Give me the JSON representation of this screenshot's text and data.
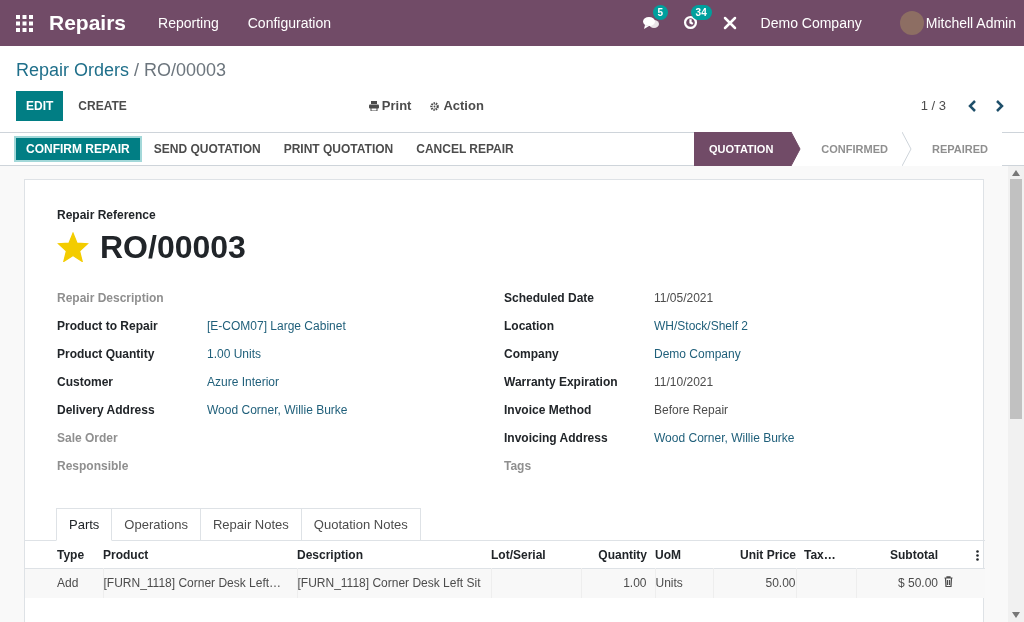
{
  "navbar": {
    "app": "Repairs",
    "menu": [
      "Reporting",
      "Configuration"
    ],
    "messages_count": "5",
    "activities_count": "34",
    "company": "Demo Company",
    "user": "Mitchell Admin"
  },
  "breadcrumb": {
    "parent": "Repair Orders",
    "separator": "/",
    "current": "RO/00003"
  },
  "buttons": {
    "edit": "EDIT",
    "create": "CREATE",
    "print": "Print",
    "action": "Action"
  },
  "pager": "1 / 3",
  "header_buttons": [
    {
      "label": "CONFIRM REPAIR",
      "primary": true
    },
    {
      "label": "SEND QUOTATION",
      "primary": false
    },
    {
      "label": "PRINT QUOTATION",
      "primary": false
    },
    {
      "label": "CANCEL REPAIR",
      "primary": false
    }
  ],
  "status_steps": [
    {
      "label": "QUOTATION",
      "selected": true
    },
    {
      "label": "CONFIRMED",
      "selected": false
    },
    {
      "label": "REPAIRED",
      "selected": false
    }
  ],
  "sheet": {
    "reference_label": "Repair Reference",
    "reference": "RO/00003",
    "starred": true,
    "left_fields": [
      {
        "label": "Repair Description",
        "empty": true
      },
      {
        "label": "Product to Repair",
        "value": "[E-COM07] Large Cabinet",
        "link": true
      },
      {
        "label": "Product Quantity",
        "value": "1.00  Units",
        "link": true
      },
      {
        "label": "Customer",
        "value": "Azure Interior",
        "link": true
      },
      {
        "label": "Delivery Address",
        "value": "Wood Corner, Willie Burke",
        "link": true
      },
      {
        "label": "Sale Order",
        "empty": true
      },
      {
        "label": "Responsible",
        "empty": true
      }
    ],
    "right_fields": [
      {
        "label": "Scheduled Date",
        "value": "11/05/2021",
        "link": false
      },
      {
        "label": "Location",
        "value": "WH/Stock/Shelf 2",
        "link": true
      },
      {
        "label": "Company",
        "value": "Demo Company",
        "link": true
      },
      {
        "label": "Warranty Expiration",
        "value": "11/10/2021",
        "link": false
      },
      {
        "label": "Invoice Method",
        "value": "Before Repair",
        "link": false
      },
      {
        "label": "Invoicing Address",
        "value": "Wood Corner, Willie Burke",
        "link": true
      },
      {
        "label": "Tags",
        "empty": true
      }
    ],
    "tabs": [
      {
        "label": "Parts",
        "selected": true
      },
      {
        "label": "Operations",
        "selected": false
      },
      {
        "label": "Repair Notes",
        "selected": false
      },
      {
        "label": "Quotation Notes",
        "selected": false
      }
    ],
    "table": {
      "columns": [
        "Type",
        "Product",
        "Description",
        "Lot/Serial",
        "Quantity",
        "UoM",
        "Unit Price",
        "Tax…",
        "Subtotal"
      ],
      "rows": [
        {
          "type": "Add",
          "product": "[FURN_1118] Corner Desk Left…",
          "description": "[FURN_1118] Corner Desk Left Sit",
          "quantity": "1.00",
          "uom": "Units",
          "unit_price": "50.00",
          "subtotal": "$ 50.00"
        }
      ]
    }
  }
}
